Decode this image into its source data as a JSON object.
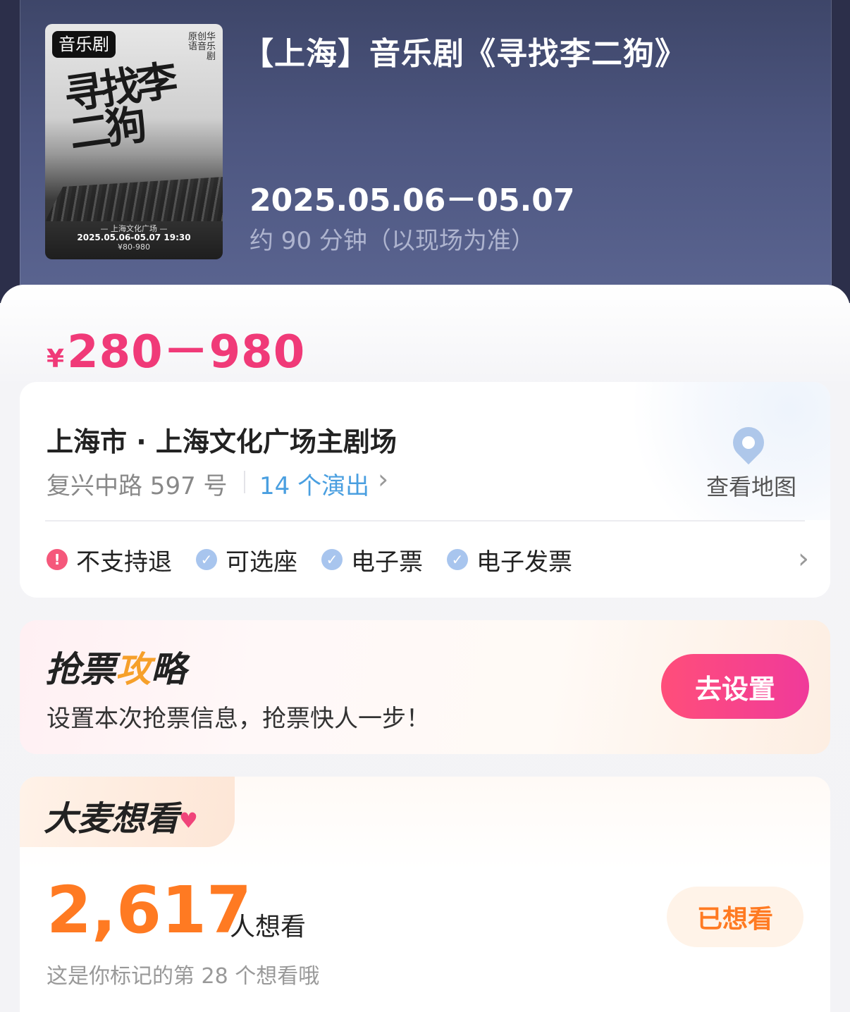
{
  "show": {
    "category_tag": "音乐剧",
    "title": "【上海】音乐剧《寻找李二狗》",
    "date_range": "2025.05.06－05.07",
    "duration": "约 90 分钟（以现场为准）",
    "poster": {
      "calligraphy": "寻找李二狗",
      "side_text": "原创华语音乐剧",
      "venue_line": "— 上海文化广场 —",
      "date_line": "2025.05.06-05.07 19:30",
      "price_line": "¥80-980"
    }
  },
  "price": {
    "currency_symbol": "¥",
    "range": "280－980"
  },
  "venue": {
    "name": "上海市 · 上海文化广场主剧场",
    "address": "复兴中路 597 号",
    "shows_link": "14 个演出",
    "map_label": "查看地图"
  },
  "policies": [
    {
      "label": "不支持退",
      "status": "warning",
      "icon": "exclamation-icon"
    },
    {
      "label": "可选座",
      "status": "ok",
      "icon": "check-icon"
    },
    {
      "label": "电子票",
      "status": "ok",
      "icon": "check-icon"
    },
    {
      "label": "电子发票",
      "status": "ok",
      "icon": "check-icon"
    }
  ],
  "strategy": {
    "title_part1": "抢票",
    "title_bolt": "攻",
    "title_part2": "略",
    "subtitle": "设置本次抢票信息，抢票快人一步！",
    "button_label": "去设置"
  },
  "want": {
    "title": "大麦想看",
    "count": "2,617",
    "unit": "人想看",
    "note": "这是你标记的第 28 个想看哦",
    "button_label": "已想看"
  },
  "colors": {
    "accent_pink": "#f03a78",
    "accent_orange": "#ff7a22",
    "link_blue": "#4a9fe0",
    "hero_bg": "#4d5680"
  }
}
